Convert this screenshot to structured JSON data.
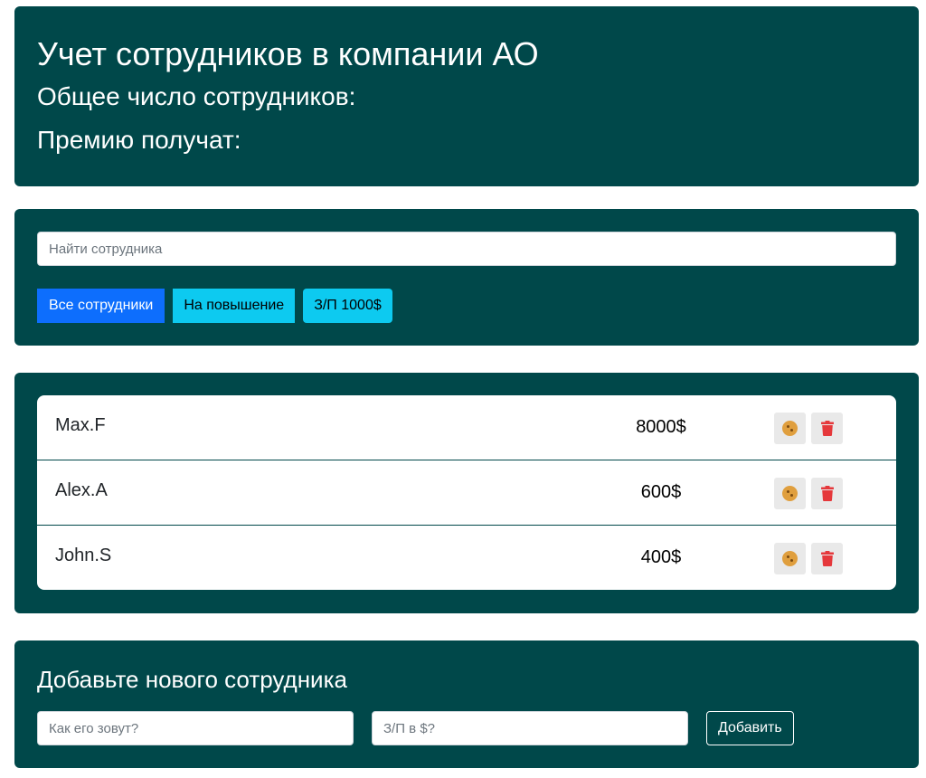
{
  "header": {
    "title": "Учет сотрудников в компании АО",
    "total_label": "Общее число сотрудников:",
    "bonus_label": "Премию получат:"
  },
  "search": {
    "placeholder": "Найти сотрудника",
    "value": ""
  },
  "filters": [
    {
      "label": "Все сотрудники",
      "active": true
    },
    {
      "label": "На повышение",
      "active": false
    },
    {
      "label": "З/П 1000$",
      "active": false
    }
  ],
  "employees": [
    {
      "name": "Max.F",
      "salary": "8000$"
    },
    {
      "name": "Alex.A",
      "salary": "600$"
    },
    {
      "name": "John.S",
      "salary": "400$"
    }
  ],
  "icons": {
    "bonus": "cookie-icon",
    "delete": "trash-icon"
  },
  "colors": {
    "panel": "#00484a",
    "primary": "#0d6efd",
    "info": "#0dcaf0",
    "cookie": "#e09f3e",
    "trash": "#e5383b"
  },
  "add_form": {
    "title": "Добавьте нового сотрудника",
    "name_placeholder": "Как его зовут?",
    "salary_placeholder": "З/П в $?",
    "submit_label": "Добавить"
  }
}
